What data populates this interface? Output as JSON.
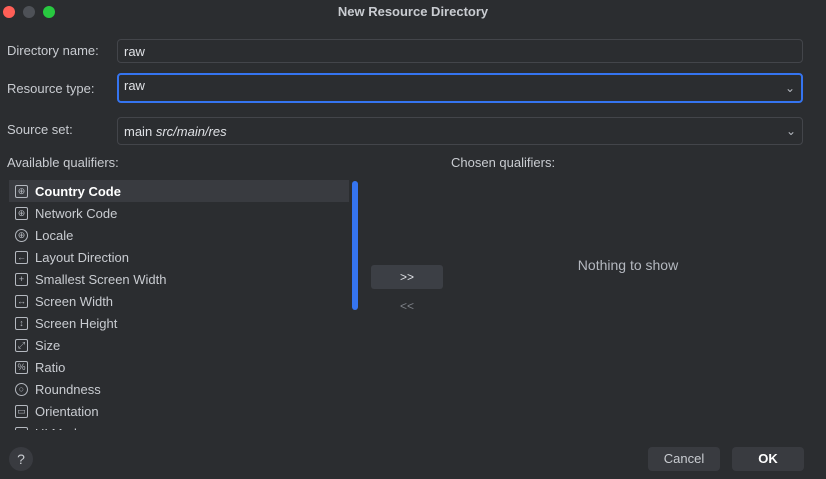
{
  "window": {
    "title": "New Resource Directory"
  },
  "form": {
    "directory_name_label": "Directory name:",
    "directory_name_value": "raw",
    "resource_type_label": "Resource type:",
    "resource_type_value": "raw",
    "source_set_label": "Source set:",
    "source_set_main": "main",
    "source_set_path": "src/main/res"
  },
  "qualifiers": {
    "available_label": "Available qualifiers:",
    "chosen_label": "Chosen qualifiers:",
    "items": [
      {
        "label": "Country Code",
        "icon": "country-code-icon",
        "glyph": "⊕"
      },
      {
        "label": "Network Code",
        "icon": "network-code-icon",
        "glyph": "⊕"
      },
      {
        "label": "Locale",
        "icon": "globe-icon",
        "glyph": "⊕"
      },
      {
        "label": "Layout Direction",
        "icon": "layout-direction-icon",
        "glyph": "←"
      },
      {
        "label": "Smallest Screen Width",
        "icon": "smallest-width-icon",
        "glyph": "+"
      },
      {
        "label": "Screen Width",
        "icon": "screen-width-icon",
        "glyph": "↔"
      },
      {
        "label": "Screen Height",
        "icon": "screen-height-icon",
        "glyph": "↕"
      },
      {
        "label": "Size",
        "icon": "size-icon",
        "glyph": "⤢"
      },
      {
        "label": "Ratio",
        "icon": "ratio-icon",
        "glyph": "%"
      },
      {
        "label": "Roundness",
        "icon": "roundness-icon",
        "glyph": "○"
      },
      {
        "label": "Orientation",
        "icon": "orientation-icon",
        "glyph": "▭"
      },
      {
        "label": "UI Mode",
        "icon": "ui-mode-icon",
        "glyph": "▯"
      }
    ],
    "add_button": ">>",
    "remove_button": "<<",
    "empty_text": "Nothing to show"
  },
  "footer": {
    "help": "?",
    "cancel": "Cancel",
    "ok": "OK"
  }
}
